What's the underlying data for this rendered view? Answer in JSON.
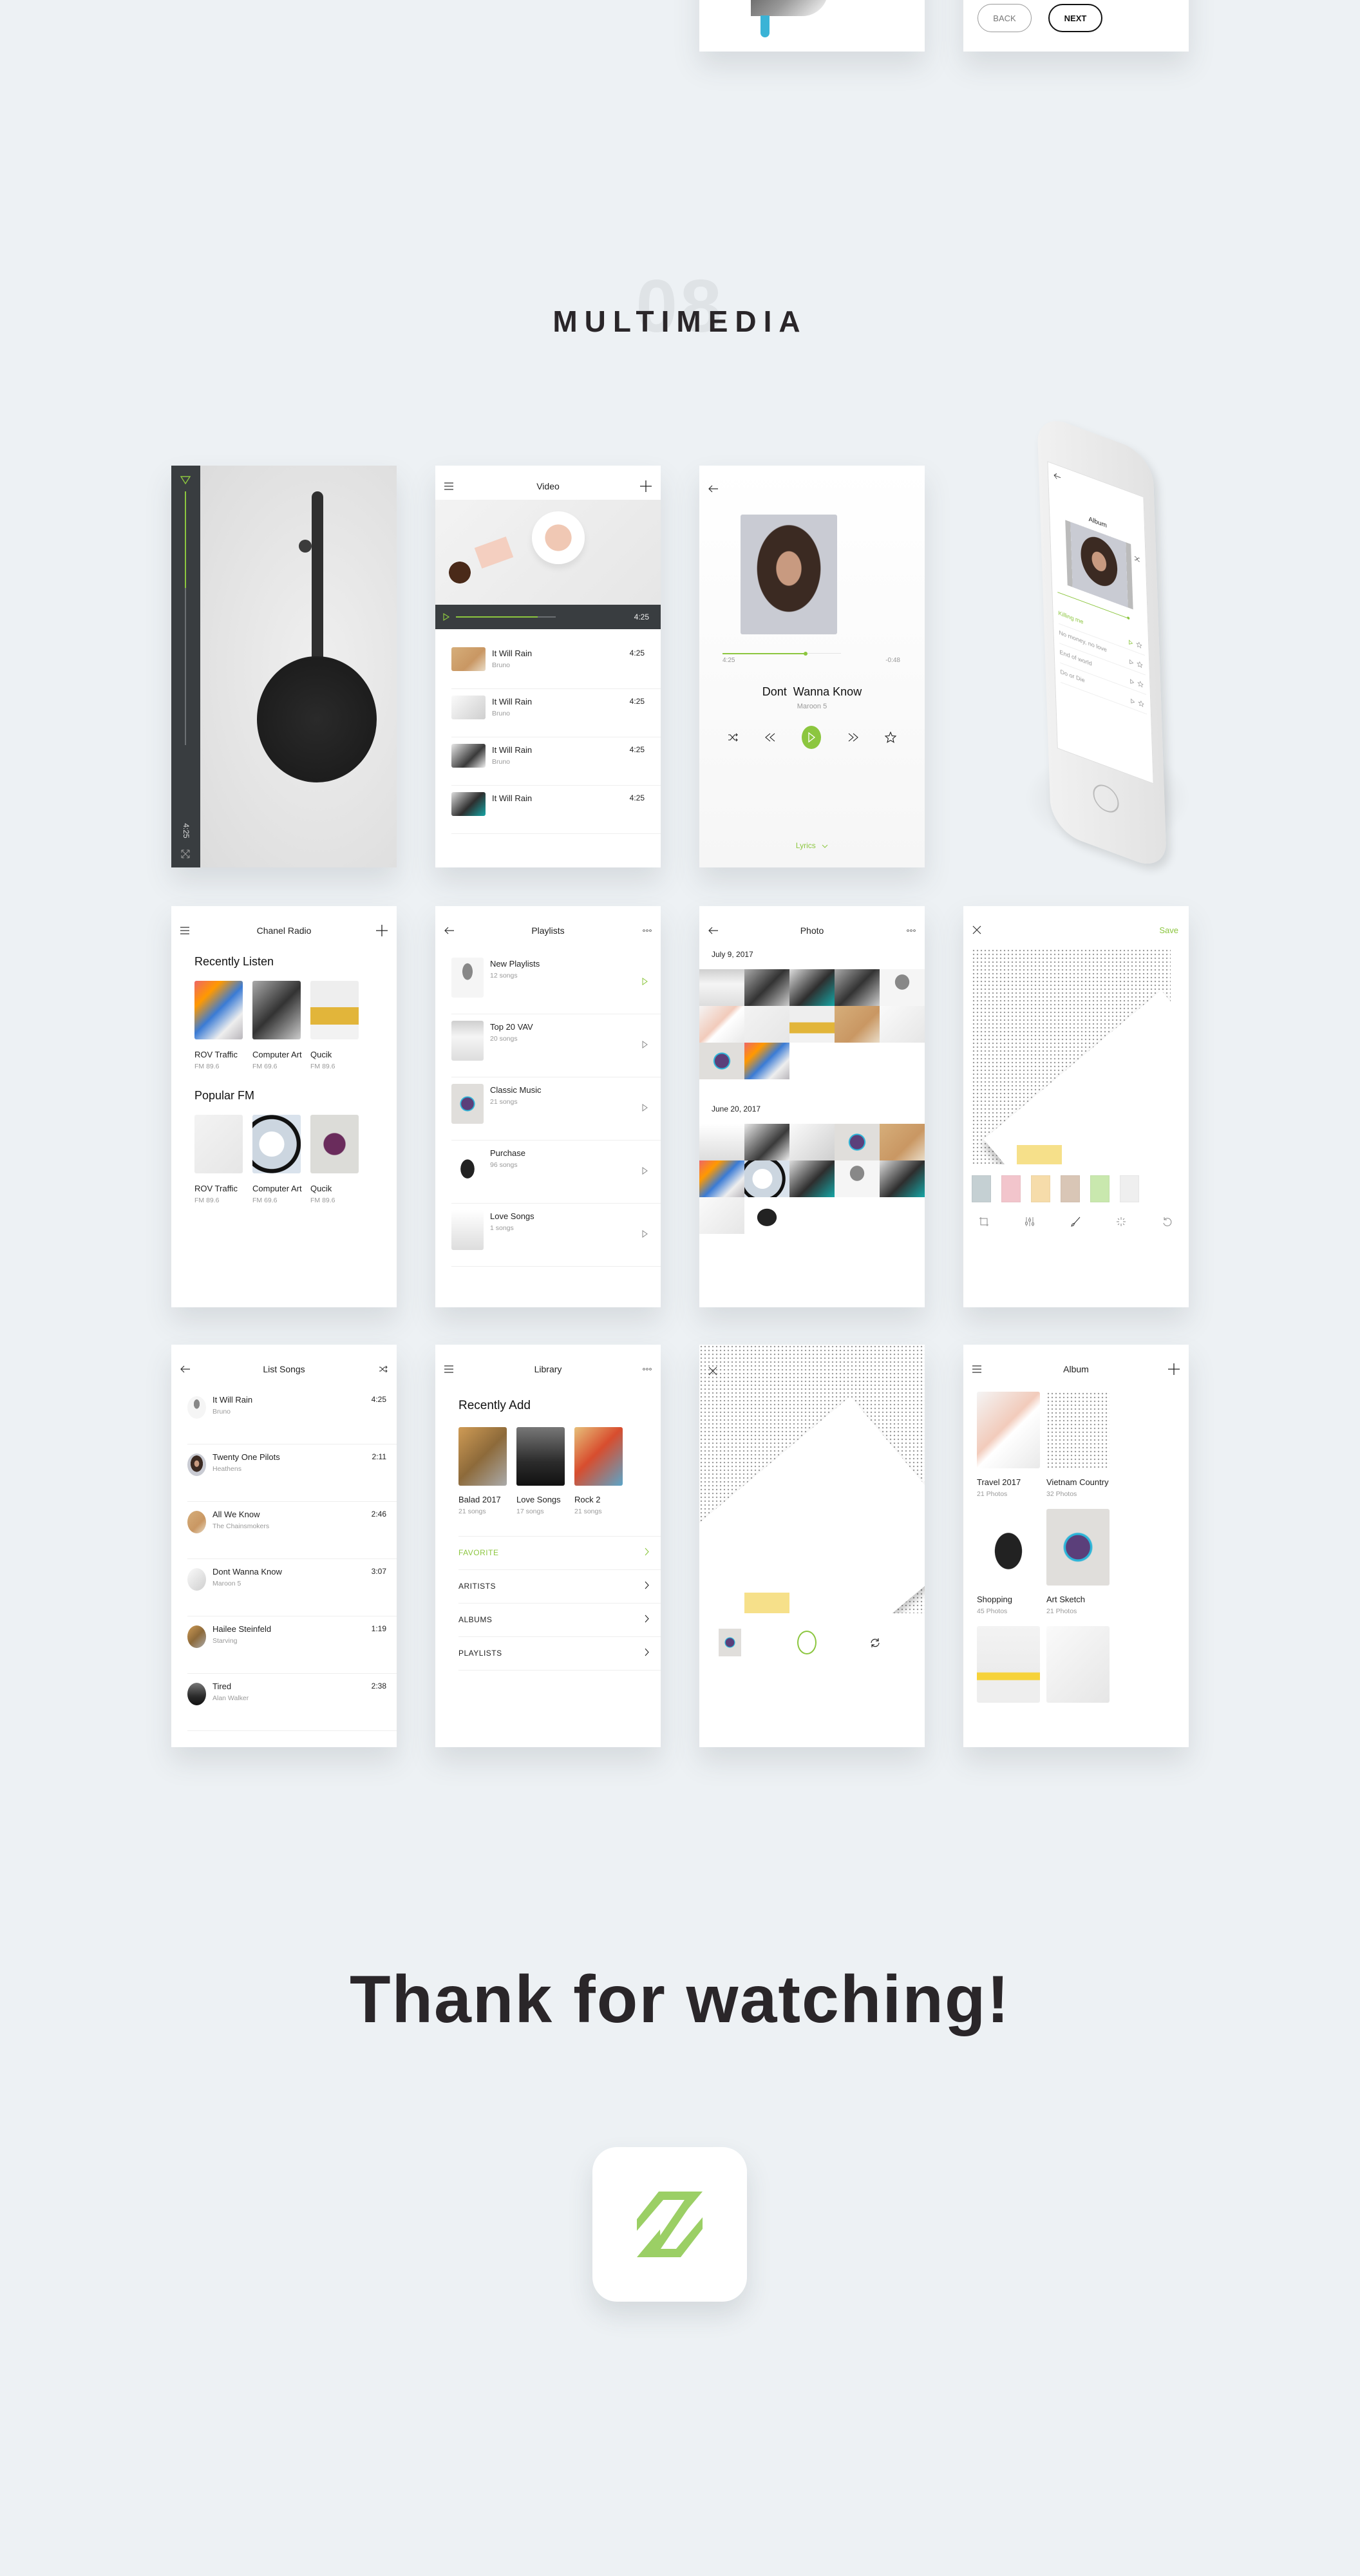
{
  "top_partial": {
    "back_label": "BACK",
    "next_label": "NEXT"
  },
  "section": {
    "number": "08",
    "title": "MULTIMEDIA"
  },
  "accent_color": "#8cc63f",
  "screens": {
    "fullscreen_player": {
      "time": "4:25",
      "progress": 0.38
    },
    "video": {
      "title": "Video",
      "player_time": "4:25",
      "progress": 0.82,
      "items": [
        {
          "title": "It Will Rain",
          "artist": "Bruno",
          "duration": "4:25"
        },
        {
          "title": "It Will Rain",
          "artist": "Bruno",
          "duration": "4:25"
        },
        {
          "title": "It Will Rain",
          "artist": "Bruno",
          "duration": "4:25"
        },
        {
          "title": "It Will Rain",
          "artist": "",
          "duration": "4:25"
        }
      ]
    },
    "now_playing": {
      "elapsed": "4:25",
      "remaining": "-0:48",
      "progress": 0.7,
      "song": "Dont  Wanna Know",
      "artist": "Maroon 5",
      "lyrics_label": "Lyrics"
    },
    "phone_album": {
      "title": "Album",
      "songs": [
        {
          "name": "Killing me",
          "active": true
        },
        {
          "name": "No money, no love",
          "active": false
        },
        {
          "name": "End of world",
          "active": false
        },
        {
          "name": "Do or Die",
          "active": false
        }
      ]
    },
    "chanel_radio": {
      "title": "Chanel Radio",
      "sections": [
        {
          "heading": "Recently Listen",
          "stations": [
            {
              "name": "ROV Traffic",
              "freq": "FM 89.6"
            },
            {
              "name": "Computer Art",
              "freq": "FM 69.6"
            },
            {
              "name": "Qucik",
              "freq": "FM 89.6"
            }
          ]
        },
        {
          "heading": "Popular FM",
          "stations": [
            {
              "name": "ROV Traffic",
              "freq": "FM 89.6"
            },
            {
              "name": "Computer Art",
              "freq": "FM 69.6"
            },
            {
              "name": "Qucik",
              "freq": "FM 89.6"
            }
          ]
        }
      ]
    },
    "playlists": {
      "title": "Playlists",
      "items": [
        {
          "name": "New Playlists",
          "count": "12 songs",
          "active": true
        },
        {
          "name": "Top 20 VAV",
          "count": "20 songs",
          "active": false
        },
        {
          "name": "Classic Music",
          "count": "21 songs",
          "active": false
        },
        {
          "name": "Purchase",
          "count": "96 songs",
          "active": false
        },
        {
          "name": "Love Songs",
          "count": "1 songs",
          "active": false
        }
      ]
    },
    "photo": {
      "title": "Photo",
      "groups": [
        {
          "date": "July 9, 2017",
          "count": 12
        },
        {
          "date": "June 20, 2017",
          "count": 12
        }
      ]
    },
    "photo_edit": {
      "save_label": "Save",
      "filters": [
        "#c5d0d3",
        "#f2c5cc",
        "#f6dcaa",
        "#d9c6b6",
        "#c9e8ae",
        "#efefef"
      ],
      "tools": [
        "crop-icon",
        "adjust-icon",
        "brush-icon",
        "sparkle-icon",
        "undo-icon"
      ]
    },
    "list_songs": {
      "title": "List Songs",
      "items": [
        {
          "title": "It Will Rain",
          "artist": "Bruno",
          "duration": "4:25"
        },
        {
          "title": "Twenty One Pilots",
          "artist": "Heathens",
          "duration": "2:11"
        },
        {
          "title": "All We Know",
          "artist": "The Chainsmokers",
          "duration": "2:46"
        },
        {
          "title": "Dont Wanna Know",
          "artist": "Maroon 5",
          "duration": "3:07"
        },
        {
          "title": "Hailee Steinfeld",
          "artist": "Starving",
          "duration": "1:19"
        },
        {
          "title": "Tired",
          "artist": "Alan Walker",
          "duration": "2:38"
        }
      ]
    },
    "library": {
      "title": "Library",
      "recent_heading": "Recently Add",
      "albums": [
        {
          "name": "Balad 2017",
          "count": "21 songs"
        },
        {
          "name": "Love Songs",
          "count": "17 songs"
        },
        {
          "name": "Rock 2",
          "count": "21 songs"
        }
      ],
      "menu": [
        {
          "label": "FAVORITE",
          "active": true
        },
        {
          "label": "ARITISTS",
          "active": false
        },
        {
          "label": "ALBUMS",
          "active": false
        },
        {
          "label": "PLAYLISTS",
          "active": false
        }
      ]
    },
    "album": {
      "title": "Album",
      "items": [
        {
          "name": "Travel 2017",
          "count": "21 Photos"
        },
        {
          "name": "Vietnam Country",
          "count": "32 Photos"
        },
        {
          "name": "Shopping",
          "count": "45 Photos"
        },
        {
          "name": "Art Sketch",
          "count": "21 Photos"
        },
        {
          "name": "",
          "count": ""
        },
        {
          "name": "",
          "count": ""
        }
      ]
    }
  },
  "footer": {
    "thanks": "Thank for watching!",
    "logo": "z-logo-icon"
  }
}
